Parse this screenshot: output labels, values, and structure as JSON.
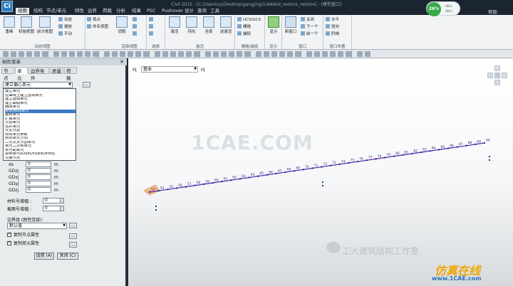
{
  "window": {
    "logo": "Ci",
    "title": "Civil 2015 - [C:\\Users\\zy\\Desktop\\gangjing\\1\\Added_restore_restore] - [模型窗口]"
  },
  "menu": {
    "items": [
      "视图",
      "结构",
      "节点/单元",
      "特性",
      "边界",
      "荷载",
      "分析",
      "结果",
      "PSC",
      "Pushover",
      "设计",
      "查询",
      "工具"
    ],
    "active_index": 0,
    "help": "帮助"
  },
  "perf": {
    "percent": "26%",
    "up": "0K/s",
    "down": "0K/s"
  },
  "ribbon": {
    "groups": [
      {
        "label": "动态视图",
        "buttons": [
          "重画",
          "初始视图",
          "前次视图"
        ],
        "small": [
          "动态",
          "缩放",
          "平动",
          "视点",
          "命名视图"
        ]
      },
      {
        "label": "渲染视图",
        "buttons": [
          "消隐"
        ],
        "small": []
      },
      {
        "label": "选择",
        "buttons": [],
        "small": []
      },
      {
        "label": "激活",
        "buttons": [
          "激活",
          "钝化",
          "全部",
          "逆激活"
        ],
        "small": []
      },
      {
        "label": "栅格/捕捉",
        "buttons": [],
        "small": [
          "UCS/GCS",
          "栅格",
          "捕捉"
        ]
      },
      {
        "label": "显示",
        "buttons": [
          "显示"
        ],
        "small": []
      },
      {
        "label": "窗口",
        "buttons": [
          "新窗口"
        ],
        "small": [
          "关闭",
          "下一个",
          "前一个"
        ]
      },
      {
        "label": "窗口布置",
        "buttons": [],
        "small": [
          "水平",
          "竖向",
          "阶梯"
        ]
      }
    ]
  },
  "panel": {
    "title": "树形菜单",
    "close": "✕",
    "tabs": [
      "节点",
      "单元",
      "边界条件",
      "质量",
      "荷载"
    ],
    "active_tab": 1,
    "select_value": "建立偏心单元",
    "ellipsis": "...",
    "dropdown_items": [
      "建立单元",
      "在曲线上建立直线单元",
      "建立直线单元",
      "建立曲线单元",
      "删除单元",
      "复制/移动单元",
      "旋转单元",
      "扩展单元",
      "分割单元",
      "合并单元",
      "交叉分割",
      "修改单元参数",
      "修改单元方向",
      "二元交叉分割单元",
      "单元二次到单元",
      "未分配单元",
      "复制单元的材料/时间依存特性",
      "交换节点"
    ],
    "dropdown_selected": 5,
    "fields": [
      {
        "label": "dx",
        "value": "0",
        "unit": "m"
      },
      {
        "label": "GDzj",
        "value": "0",
        "unit": "m"
      },
      {
        "label": "GDxj",
        "value": "0",
        "unit": "m"
      },
      {
        "label": "GDyj",
        "value": "0",
        "unit": "m"
      },
      {
        "label": "GDzj",
        "value": "0",
        "unit": "m"
      }
    ],
    "material_inc_label": "材料号增幅",
    "material_inc": "0",
    "section_inc_label": "截面号增幅",
    "section_inc": "0",
    "boundary_label": "边界组 (刚性连接):",
    "boundary_value": "默认值",
    "copy_node_label": "复制节点属性",
    "copy_elem_label": "复制单元属性",
    "apply_label": "适用 (A)",
    "close_label": "关闭 (C)"
  },
  "viewport": {
    "combo_value": "基本",
    "watermark": "1CAE.COM",
    "wechat_text": "工大建筑结构工作室",
    "brand": "仿真在线",
    "brand_sub": "www.1CAE.com",
    "node_labels": [
      "53",
      "54",
      "55",
      "56",
      "57",
      "58",
      "59",
      "60",
      "61",
      "62",
      "63",
      "64",
      "65",
      "66",
      "67",
      "68",
      "69",
      "70",
      "71",
      "72",
      "73",
      "74",
      "75",
      "76",
      "77",
      "78",
      "79",
      "80",
      "81",
      "82",
      "83",
      "84",
      "85",
      "86",
      "87",
      "88",
      "89",
      "90"
    ]
  }
}
